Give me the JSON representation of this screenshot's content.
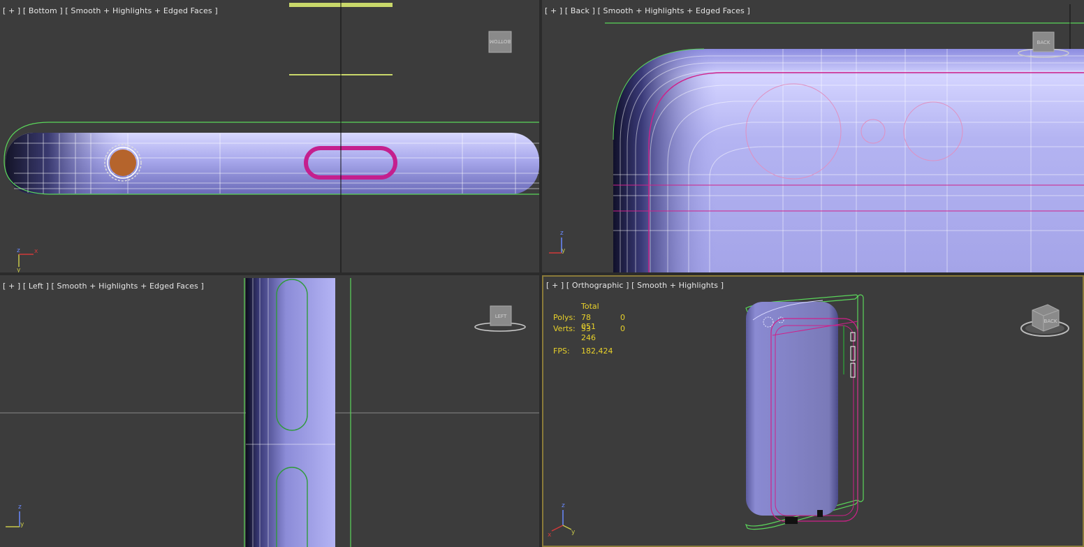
{
  "viewports": [
    {
      "id": "bottom",
      "label": "[ + ] [ Bottom ] [ Smooth + Highlights + Edged Faces ]",
      "viewcube": "BOTTOM"
    },
    {
      "id": "back",
      "label": "[ + ] [ Back ] [ Smooth + Highlights + Edged Faces ]",
      "viewcube": "BACK"
    },
    {
      "id": "left",
      "label": "[ + ] [ Left ] [ Smooth + Highlights + Edged Faces ]",
      "viewcube": "LEFT"
    },
    {
      "id": "ortho",
      "label": "[ + ] [ Orthographic ] [ Smooth + Highlights ]",
      "viewcube": "BACK"
    }
  ],
  "stats": {
    "header": "Total",
    "polys_label": "Polys:",
    "polys_total": "78 051",
    "polys_sel": "0",
    "verts_label": "Verts:",
    "verts_total": "53 246",
    "verts_sel": "0",
    "fps_label": "FPS:",
    "fps_value": "182,424"
  },
  "axes": {
    "z": "z",
    "x": "x",
    "y": "y"
  },
  "colors": {
    "viewport_bg": "#3c3c3c",
    "active_border": "#8a7a3a",
    "mesh": "#b0b0f0",
    "wire": "#ffffff",
    "selection": "#d0208a",
    "spline": "#5ad65a",
    "stats_text": "#e8d12a"
  }
}
